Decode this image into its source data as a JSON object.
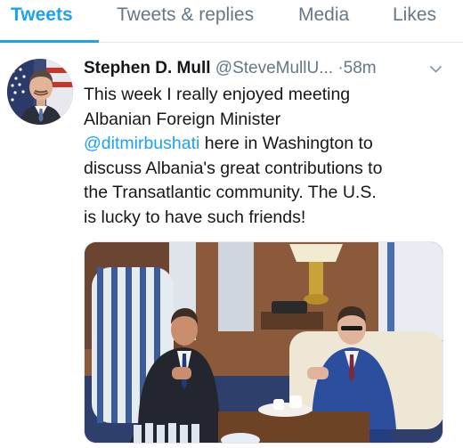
{
  "tabs": [
    {
      "label": "Tweets",
      "active": true
    },
    {
      "label": "Tweets & replies",
      "active": false
    },
    {
      "label": "Media",
      "active": false
    },
    {
      "label": "Likes",
      "active": false
    }
  ],
  "tweet": {
    "author_name": "Stephen D. Mull",
    "author_handle": "@SteveMullU...",
    "separator": "·",
    "time": "58m",
    "text_lines": [
      "This week I really enjoyed meeting",
      "Albanian Foreign Minister",
      "here in Washington to",
      "discuss Albania's great contributions to",
      "the Transatlantic community.  The U.S.",
      "is lucky to have such friends!"
    ],
    "mention": "@ditmirbushati",
    "menu_icon": "chevron-down-icon",
    "avatar_icon": "profile-photo-with-us-flag"
  },
  "colors": {
    "accent": "#1da1f2",
    "secondary_text": "#657786",
    "primary_text": "#14171a",
    "divider": "#e1e8ed"
  }
}
